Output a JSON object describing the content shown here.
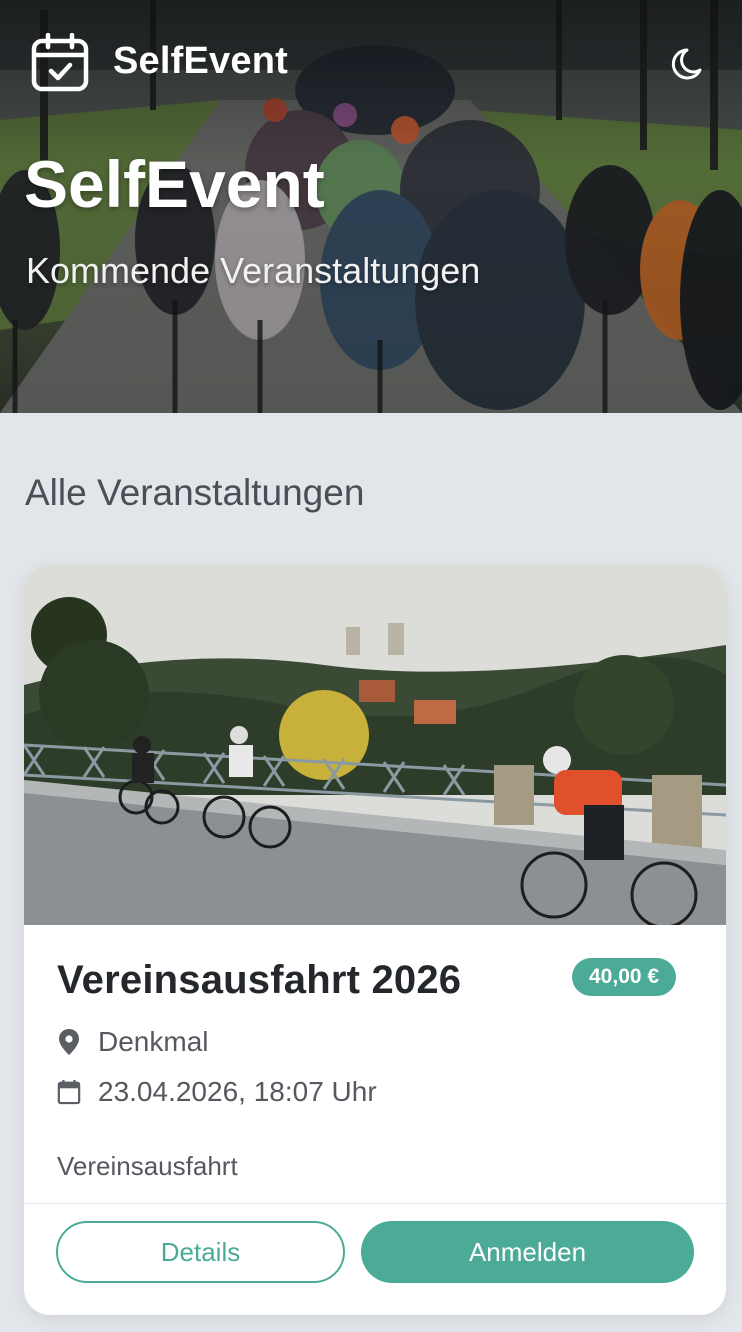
{
  "header": {
    "brand_name": "SelfEvent",
    "brand_icon": "calendar-check-icon",
    "theme_toggle_icon": "moon-icon"
  },
  "hero": {
    "title": "SelfEvent",
    "subtitle": "Kommende Veranstaltungen"
  },
  "section": {
    "title": "Alle Veranstaltungen"
  },
  "events": [
    {
      "title": "Vereinsausfahrt 2026",
      "price": "40,00 €",
      "location": "Denkmal",
      "datetime": "23.04.2026, 18:07 Uhr",
      "description": "Vereinsausfahrt",
      "details_label": "Details",
      "register_label": "Anmelden"
    }
  ],
  "colors": {
    "accent": "#4bab97",
    "background": "#e2e5e9",
    "card": "#ffffff",
    "text_dark": "#24272b",
    "text_muted": "#55595f"
  }
}
